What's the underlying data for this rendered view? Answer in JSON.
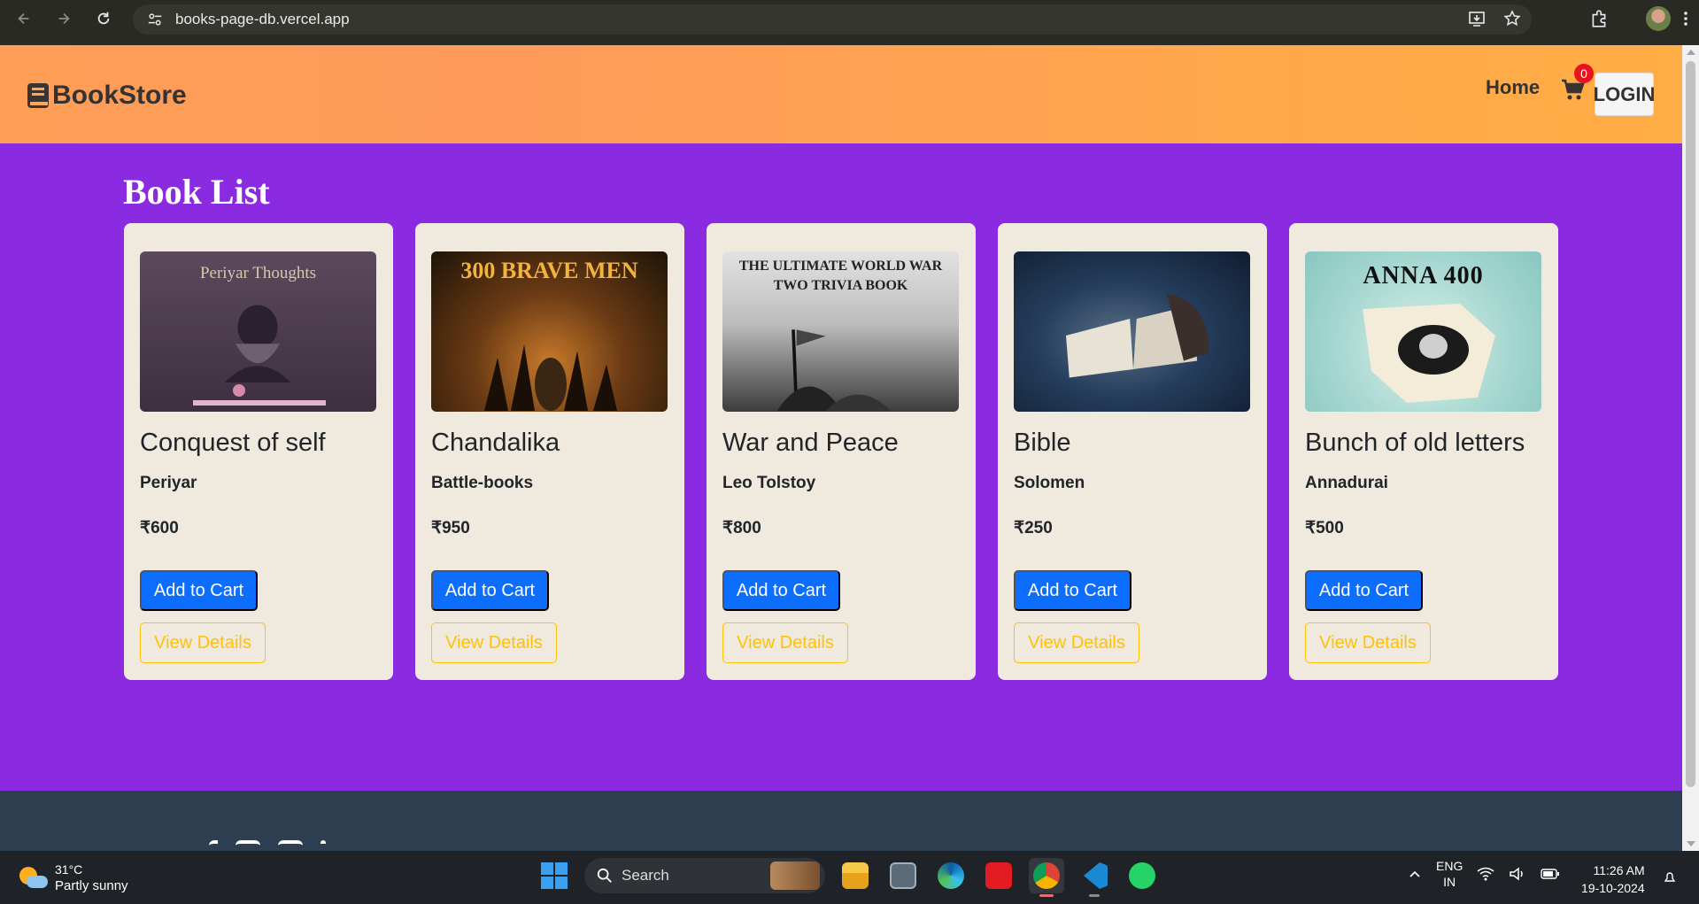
{
  "browser": {
    "url": "books-page-db.vercel.app"
  },
  "header": {
    "brand": "BookStore",
    "nav_home": "Home",
    "cart_count": "0",
    "login_label": "LOGIN"
  },
  "section_title": "Book List",
  "books": [
    {
      "title": "Conquest of self",
      "author": "Periyar",
      "price": "₹600",
      "cover_text": "Periyar Thoughts",
      "cover_color": "#4c3b4d"
    },
    {
      "title": "Chandalika",
      "author": "Battle-books",
      "price": "₹950",
      "cover_text": "300 BRAVE MEN",
      "cover_color": "#3a2a12"
    },
    {
      "title": "War and Peace",
      "author": "Leo Tolstoy",
      "price": "₹800",
      "cover_text": "THE ULTIMATE WORLD WAR TWO TRIVIA BOOK",
      "cover_color": "#6b6b6b"
    },
    {
      "title": "Bible",
      "author": "Solomen",
      "price": "₹250",
      "cover_text": "",
      "cover_color": "#1f3550"
    },
    {
      "title": "Bunch of old letters",
      "author": "Annadurai",
      "price": "₹500",
      "cover_text": "ANNA 400",
      "cover_color": "#9fd2cd"
    }
  ],
  "buttons": {
    "add_to_cart": "Add to Cart",
    "view_details": "View Details"
  },
  "taskbar": {
    "weather_temp": "31°C",
    "weather_desc": "Partly sunny",
    "search_placeholder": "Search",
    "lang_line1": "ENG",
    "lang_line2": "IN",
    "time": "11:26 AM",
    "date": "19-10-2024"
  },
  "colors": {
    "page_bg": "#8a2be2",
    "card_bg": "#f0e9dd",
    "primary": "#0d6efd",
    "warning": "#ffc107",
    "footer_bg": "#2c3e50",
    "badge": "#e8131f"
  }
}
